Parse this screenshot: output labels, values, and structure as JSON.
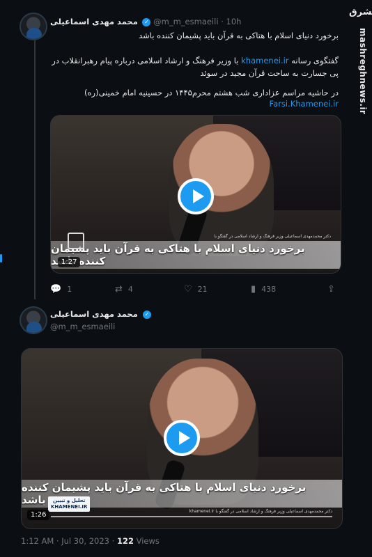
{
  "watermark": {
    "site": "mashreghnews.ir",
    "logo": "مشرق"
  },
  "tweet1": {
    "author_name": "محمد مهدی اسماعیلی",
    "handle": "@m_m_esmaeili",
    "separator": "·",
    "time": "10h",
    "line1": "برخورد دنیای اسلام با هتاکی به قرآن باید پشیمان کننده باشد",
    "para2_before": "گفتگوی رسانه ",
    "para2_link": "khamenei.ir",
    "para2_after": " با وزیر فرهنگ و ارشاد اسلامی درباره پیام رهبرانقلاب در پی جسارت به ساحت قرآن مجید در سوئد",
    "para3": "در حاشیه مراسم عزاداری شب هشتم محرم۱۴۴۵ در حسینیه امام خمینی(ره)",
    "para3_link": "Farsi.Khamenei.ir",
    "video": {
      "caption": "برخورد دنیای اسلام با هتاکی به قرآن باید پشیمان کننده باشد",
      "subcaption": "دکتر محمدمهدی اسماعیلی وزیر فرهنگ و ارشاد اسلامی در گفتگو با",
      "duration": "1:27"
    },
    "actions": {
      "replies": "1",
      "retweets": "4",
      "likes": "21",
      "views": "438"
    }
  },
  "tweet2": {
    "author_name": "محمد مهدی اسماعیلی",
    "handle": "@m_m_esmaeili",
    "video": {
      "caption": "برخورد دنیای اسلام با هتاکی به قرآن باید پشیمان کننده باشد",
      "subcaption": "دکتر محمدمهدی اسماعیلی وزیر فرهنگ و ارشاد اسلامی در گفتگو با",
      "source": "khamenei.ir",
      "badge1": "تحلیل و تبیین",
      "badge2": "KHAMENEI.IR",
      "duration": "1:26",
      "progress": 0.0
    },
    "meta_time": "1:12 AM · Jul 30, 2023 · ",
    "views_count": "122",
    "views_label": " Views"
  }
}
